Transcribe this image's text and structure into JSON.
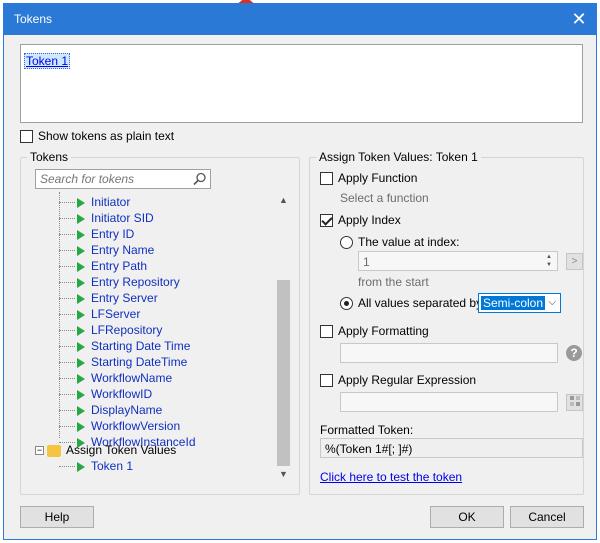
{
  "window": {
    "title": "Tokens",
    "close_glyph": "✕"
  },
  "token_editor": {
    "token_text": "Token 1"
  },
  "show_plain": {
    "label": "Show tokens as plain text",
    "checked": false
  },
  "tokens_panel": {
    "group_title": "Tokens",
    "search_placeholder": "Search for tokens",
    "items": [
      "Initiator",
      "Initiator SID",
      "Entry ID",
      "Entry Name",
      "Entry Path",
      "Entry Repository",
      "Entry Server",
      "LFServer",
      "LFRepository",
      "Starting Date Time",
      "Starting DateTime",
      "WorkflowName",
      "WorkflowID",
      "DisplayName",
      "WorkflowVersion",
      "WorkflowInstanceId"
    ],
    "assign_node": "Assign Token Values",
    "assign_child": "Token 1"
  },
  "assign_panel": {
    "group_title": "Assign Token Values: Token 1",
    "apply_function": {
      "label": "Apply Function",
      "checked": false,
      "hint": "Select a function"
    },
    "apply_index": {
      "label": "Apply Index",
      "checked": true
    },
    "value_at_index": {
      "label": "The value at index:",
      "selected": false,
      "value": "1",
      "hint": "from the  start",
      "button": ">"
    },
    "all_values": {
      "label": "All values separated by:",
      "selected": true,
      "separator": "Semi-colon"
    },
    "apply_formatting": {
      "label": "Apply Formatting",
      "checked": false
    },
    "apply_regex": {
      "label": "Apply Regular Expression",
      "checked": false
    },
    "formatted_token_label": "Formatted Token:",
    "formatted_token_value": "%(Token 1#[; ]#)",
    "test_link": "Click here to test the token"
  },
  "footer": {
    "help": "Help",
    "ok": "OK",
    "cancel": "Cancel"
  },
  "colors": {
    "titlebar": "#2b79d6",
    "tree_text": "#1030c0",
    "play_icon": "#28a745",
    "select_highlight": "#0078d7"
  }
}
